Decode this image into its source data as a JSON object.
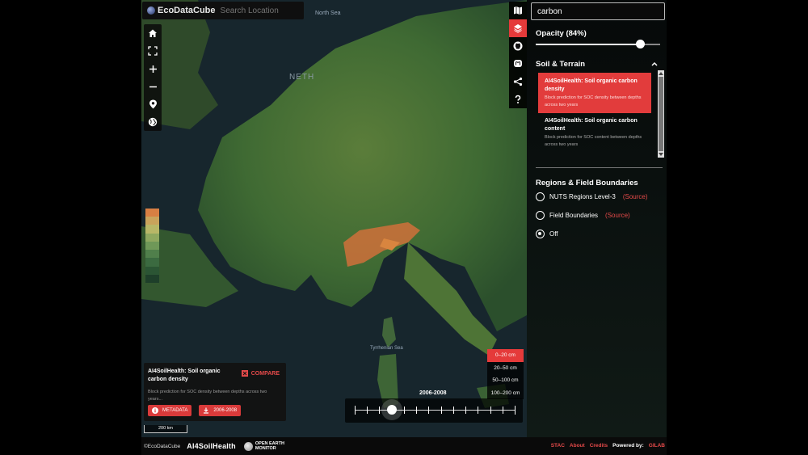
{
  "app": {
    "logo_text": "EcoDataCube",
    "search_placeholder": "Search Location"
  },
  "map": {
    "labels": {
      "north_sea": "North Sea",
      "netherlands_partial": "NETH",
      "tyrrhenian_sea": "Tyrrhenian Sea"
    },
    "legend_colors": [
      "#d77f43",
      "#c9a35b",
      "#b8b767",
      "#8fa85f",
      "#6f9858",
      "#507f4b",
      "#3b6a40",
      "#2b5534",
      "#1e3f2a"
    ],
    "scale_label": "200 km"
  },
  "left_tools": [
    {
      "name": "home-icon"
    },
    {
      "name": "fullscreen-icon"
    },
    {
      "name": "zoom-in-icon"
    },
    {
      "name": "zoom-out-icon"
    },
    {
      "name": "location-pin-icon"
    },
    {
      "name": "globe-icon"
    }
  ],
  "right_tools": [
    {
      "name": "map-icon",
      "active": false
    },
    {
      "name": "layers-icon",
      "active": true
    },
    {
      "name": "github-icon",
      "active": false
    },
    {
      "name": "mastodon-icon",
      "active": false
    },
    {
      "name": "share-icon",
      "active": false
    },
    {
      "name": "help-icon",
      "active": false
    }
  ],
  "info_card": {
    "title": "AI4SoilHealth: Soil organic carbon density",
    "compare_label": "COMPARE",
    "description": "Block prediction for SOC density between depths across two years...",
    "metadata_label": "METADATA",
    "download_label": "2006-2008"
  },
  "time_slider": {
    "label": "2006-2008",
    "ticks": 14,
    "selected_index": 3
  },
  "depths": [
    {
      "label": "0–20 cm",
      "active": true
    },
    {
      "label": "20–50 cm",
      "active": false
    },
    {
      "label": "50–100 cm",
      "active": false
    },
    {
      "label": "100–200 cm",
      "active": false
    }
  ],
  "footer": {
    "copyright": "©EcoDataCube",
    "brand1": "AI4SoilHealth",
    "brand2_line1": "OPEN EARTH",
    "brand2_line2": "MONITOR",
    "links": {
      "stac": "STAC",
      "about": "About",
      "credits": "Credits",
      "powered_by": "Powered by:",
      "gilab": "GILAB"
    }
  },
  "panel": {
    "filter_value": "carbon",
    "opacity_label": "Opacity (84%)",
    "opacity_value": 0.84,
    "section_soil": "Soil & Terrain",
    "layers": [
      {
        "title": "AI4SoilHealth: Soil organic carbon density",
        "desc": "Block prediction for SOC density between depths across two years",
        "active": true
      },
      {
        "title": "AI4SoilHealth: Soil organic carbon content",
        "desc": "Block prediction for SOC content between depths across two years",
        "active": false
      }
    ],
    "section_regions": "Regions & Field Boundaries",
    "regions": [
      {
        "label": "NUTS Regions Level-3",
        "source": "(Source)",
        "selected": false
      },
      {
        "label": "Field Boundaries",
        "source": "(Source)",
        "selected": false
      },
      {
        "label": "Off",
        "source": "",
        "selected": true
      }
    ]
  },
  "colors": {
    "accent": "#e53a3a",
    "link": "#e54a4a"
  }
}
